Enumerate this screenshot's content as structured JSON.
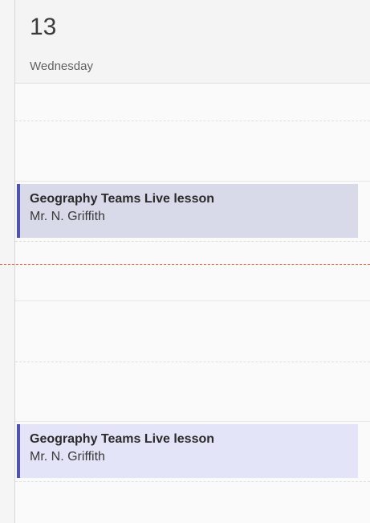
{
  "day": {
    "number": "13",
    "name": "Wednesday"
  },
  "events": [
    {
      "title": "Geography Teams Live lesson",
      "organizer": "Mr. N. Griffith"
    },
    {
      "title": "Geography Teams Live lesson",
      "organizer": "Mr. N. Griffith"
    }
  ],
  "colors": {
    "accent": "#4f52b2",
    "event_bg": "#d8daea",
    "event_bg_light": "#e3e4f7",
    "now_line": "#d84a2c"
  }
}
